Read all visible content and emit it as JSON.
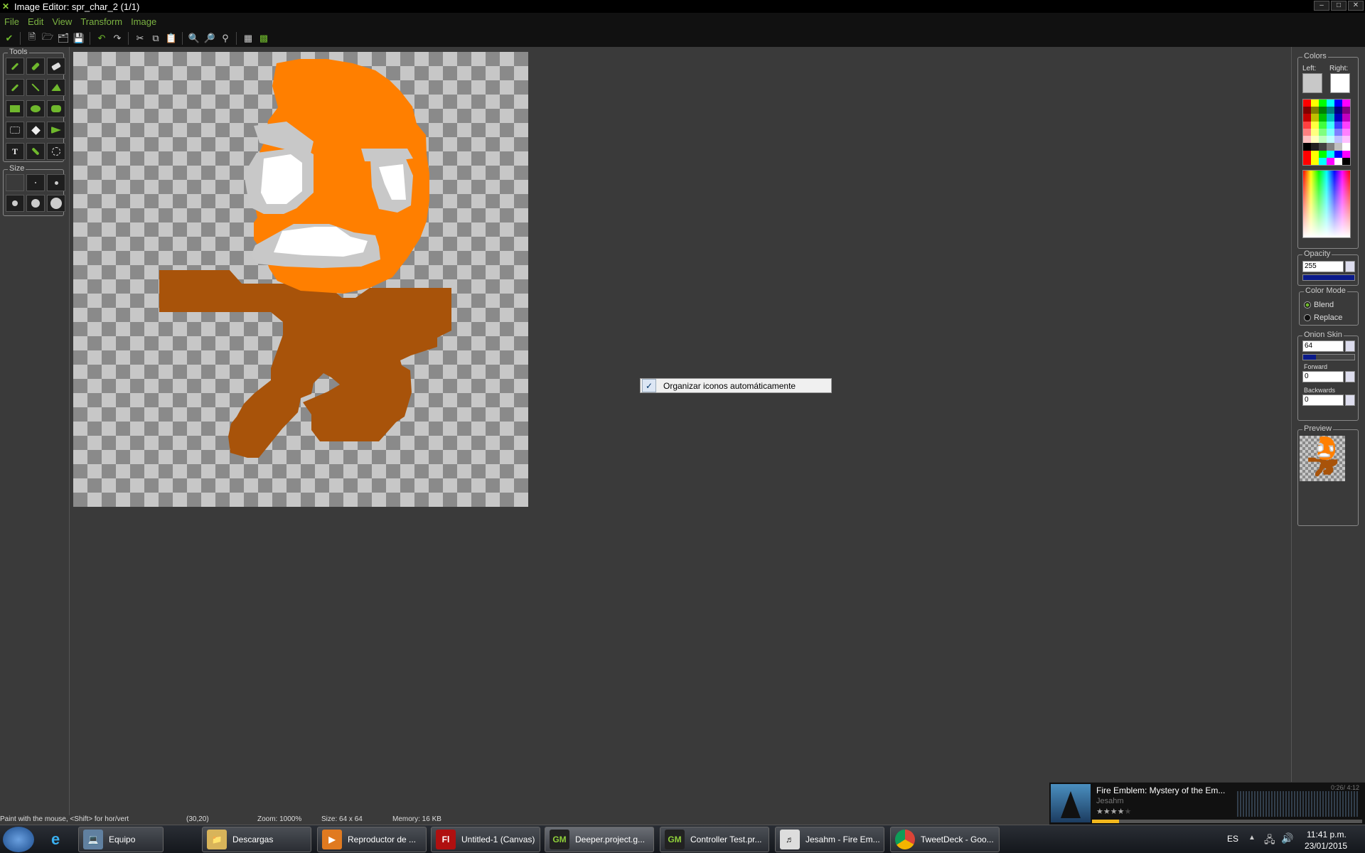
{
  "window": {
    "title": "Image Editor: spr_char_2 (1/1)",
    "controls": [
      "minimize-icon",
      "restore-icon",
      "close-icon"
    ]
  },
  "menu": [
    "File",
    "Edit",
    "View",
    "Transform",
    "Image"
  ],
  "toolbar": {
    "icons": [
      "checkmark-icon",
      "new-icon",
      "open-icon",
      "import-icon",
      "save-icon",
      "undo-icon",
      "redo-icon",
      "cut-icon",
      "copy-icon",
      "paste-icon",
      "zoom-in-icon",
      "zoom-out-icon",
      "zoom-reset-icon",
      "grid-icon",
      "preview-icon"
    ]
  },
  "tools": {
    "title": "Tools",
    "items": [
      "pencil-icon",
      "spray-icon",
      "eraser-icon",
      "color-picker-icon",
      "line-icon",
      "polygon-icon",
      "rectangle-icon",
      "ellipse-icon",
      "rounded-rectangle-icon",
      "select-icon",
      "magic-wand-icon",
      "flood-fill-icon",
      "text-icon",
      "change-color-icon",
      "lasso-icon"
    ]
  },
  "size": {
    "title": "Size"
  },
  "colors": {
    "title": "Colors",
    "left_label": "Left:",
    "right_label": "Right:",
    "left_color": "#c8c8c8",
    "right_color": "#ffffff"
  },
  "opacity": {
    "title": "Opacity",
    "value": "255"
  },
  "color_mode": {
    "title": "Color Mode",
    "options": [
      "Blend",
      "Replace"
    ],
    "selected": "Blend"
  },
  "onion_skin": {
    "title": "Onion Skin",
    "value": "64",
    "forward_label": "Forward",
    "forward_value": "0",
    "backwards_label": "Backwards",
    "backwards_value": "0"
  },
  "preview": {
    "title": "Preview"
  },
  "context_menu": {
    "item": "Organizar iconos automáticamente",
    "checked": true
  },
  "status": {
    "hint": "Paint with the mouse, <Shift> for hor/vert",
    "coords": "(30,20)",
    "zoom": "Zoom: 1000%",
    "size": "Size: 64 x 64",
    "memory": "Memory: 16 KB"
  },
  "taskbar": {
    "tasks": [
      {
        "label": "Equipo",
        "icon": "computer-icon"
      },
      {
        "label": "Descargas",
        "icon": "folder-icon"
      },
      {
        "label": "Reproductor de ...",
        "icon": "media-player-icon"
      },
      {
        "label": "Untitled-1 (Canvas)",
        "icon": "flash-icon"
      },
      {
        "label": "Deeper.project.g...",
        "icon": "gamemaker-icon"
      },
      {
        "label": "Controller Test.pr...",
        "icon": "gamemaker-icon"
      },
      {
        "label": "Jesahm - Fire Em...",
        "icon": "music-player-icon"
      },
      {
        "label": "TweetDeck - Goo...",
        "icon": "chrome-icon"
      }
    ],
    "lang": "ES",
    "time": "11:41 p.m.",
    "date": "23/01/2015"
  },
  "music": {
    "title": "Fire Emblem: Mystery of the Em...",
    "artist": "Jesahm",
    "progress": "0:26/ 4:12",
    "rating": 4
  },
  "sprite_colors": {
    "orange": "#ff7f00",
    "brown": "#a8530a",
    "white": "#ffffff",
    "grey": "#c8c8c8"
  }
}
